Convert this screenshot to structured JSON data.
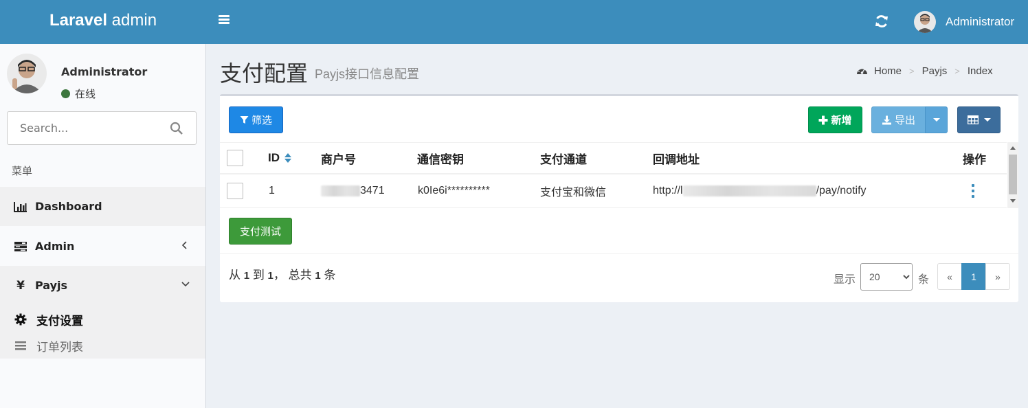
{
  "header": {
    "logo_bold": "Laravel",
    "logo_rest": " admin",
    "user_name": "Administrator"
  },
  "sidebar": {
    "user_name": "Administrator",
    "user_status": "在线",
    "search_placeholder": "Search...",
    "menu_header": "菜单",
    "items": [
      {
        "label": "Dashboard",
        "icon": "bar-chart-icon"
      },
      {
        "label": "Admin",
        "icon": "tasks-icon"
      },
      {
        "label": "Payjs",
        "icon": "yen-icon"
      }
    ],
    "subitems": [
      {
        "label": "支付设置",
        "icon": "gear-icon",
        "active": true
      },
      {
        "label": "订单列表",
        "icon": "list-icon",
        "active": false
      }
    ]
  },
  "page": {
    "title": "支付配置",
    "subtitle": "Payjs接口信息配置",
    "breadcrumb": [
      "Home",
      "Payjs",
      "Index"
    ]
  },
  "toolbar": {
    "filter_label": "筛选",
    "add_label": "新增",
    "export_label": "导出"
  },
  "table": {
    "columns": [
      "ID",
      "商户号",
      "通信密钥",
      "支付通道",
      "回调地址",
      "操作"
    ],
    "rows": [
      {
        "id": "1",
        "merchant_suffix": "3471",
        "secret": "k0Ie6i**********",
        "channel": "支付宝和微信",
        "callback_prefix": "http://l",
        "callback_suffix": "/pay/notify"
      }
    ]
  },
  "test_button_label": "支付测试",
  "footer": {
    "summary_from": "从",
    "summary_start": "1",
    "summary_to": "到",
    "summary_end": "1",
    "summary_total_prefix": "， 总共",
    "summary_total": "1",
    "summary_unit": "条",
    "perpage_label": "显示",
    "perpage_value": "20",
    "perpage_unit": "条",
    "pager_prev": "«",
    "pager_current": "1",
    "pager_next": "»"
  },
  "colors": {
    "header": "#3c8dbc",
    "primary": "#1e88e5",
    "success": "#00a65a",
    "test_button": "#3d9a3a",
    "status_online": "#3c763d"
  }
}
